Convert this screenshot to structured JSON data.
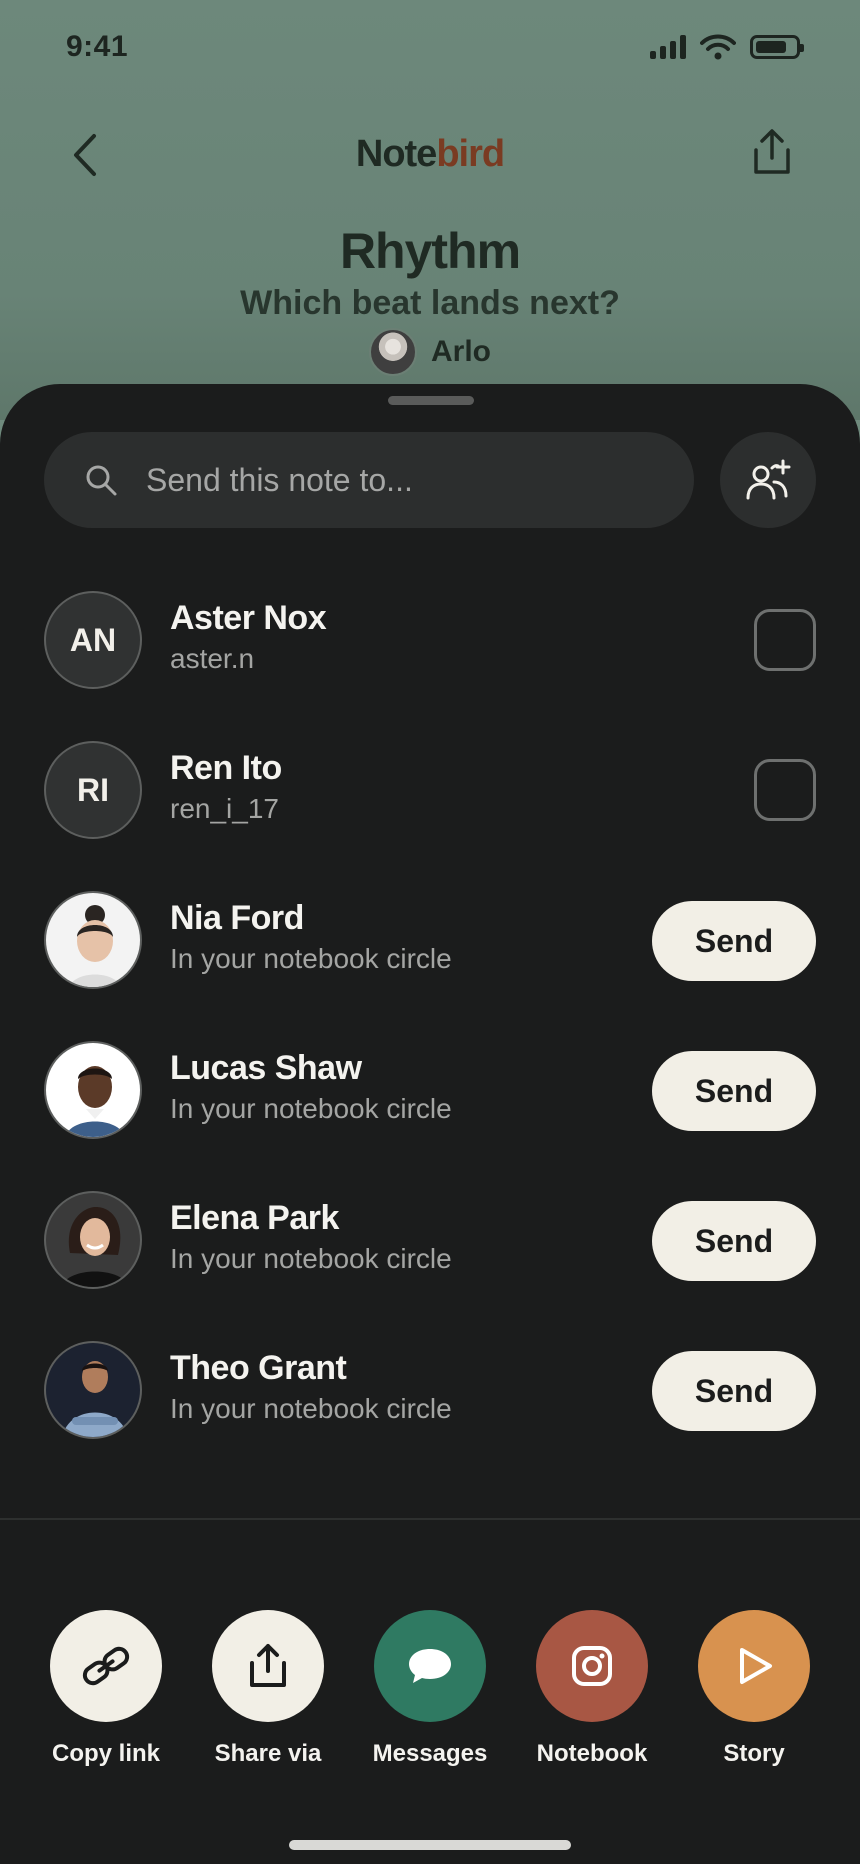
{
  "status_bar": {
    "time": "9:41"
  },
  "header": {
    "brand_part1": "Note",
    "brand_part2": "bird",
    "note_title": "Rhythm",
    "note_subtitle": "Which beat lands next?",
    "author_name": "Arlo"
  },
  "search": {
    "placeholder": "Send this note to..."
  },
  "contacts": [
    {
      "initials": "AN",
      "name": "Aster Nox",
      "subtitle": "aster.n",
      "action": "checkbox"
    },
    {
      "initials": "RI",
      "name": "Ren Ito",
      "subtitle": "ren_i_17",
      "action": "checkbox"
    },
    {
      "name": "Nia Ford",
      "subtitle": "In your notebook circle",
      "action": "send",
      "send_label": "Send"
    },
    {
      "name": "Lucas Shaw",
      "subtitle": "In your notebook circle",
      "action": "send",
      "send_label": "Send"
    },
    {
      "name": "Elena Park",
      "subtitle": "In your notebook circle",
      "action": "send",
      "send_label": "Send"
    },
    {
      "name": "Theo Grant",
      "subtitle": "In your notebook circle",
      "action": "send",
      "send_label": "Send"
    }
  ],
  "share_options": [
    {
      "label": "Copy link",
      "icon": "link-icon",
      "color": "#f2efe6"
    },
    {
      "label": "Share via",
      "icon": "share-icon",
      "color": "#f2efe6"
    },
    {
      "label": "Messages",
      "icon": "message-bubble-icon",
      "color": "#2f7a62"
    },
    {
      "label": "Notebook",
      "icon": "camera-icon",
      "color": "#a85744"
    },
    {
      "label": "Story",
      "icon": "play-icon",
      "color": "#d8924f"
    }
  ],
  "colors": {
    "background_app": "#6d887b",
    "sheet": "#1b1c1c",
    "brand_accent": "#7a3b22",
    "send_button": "#f2efe6"
  }
}
